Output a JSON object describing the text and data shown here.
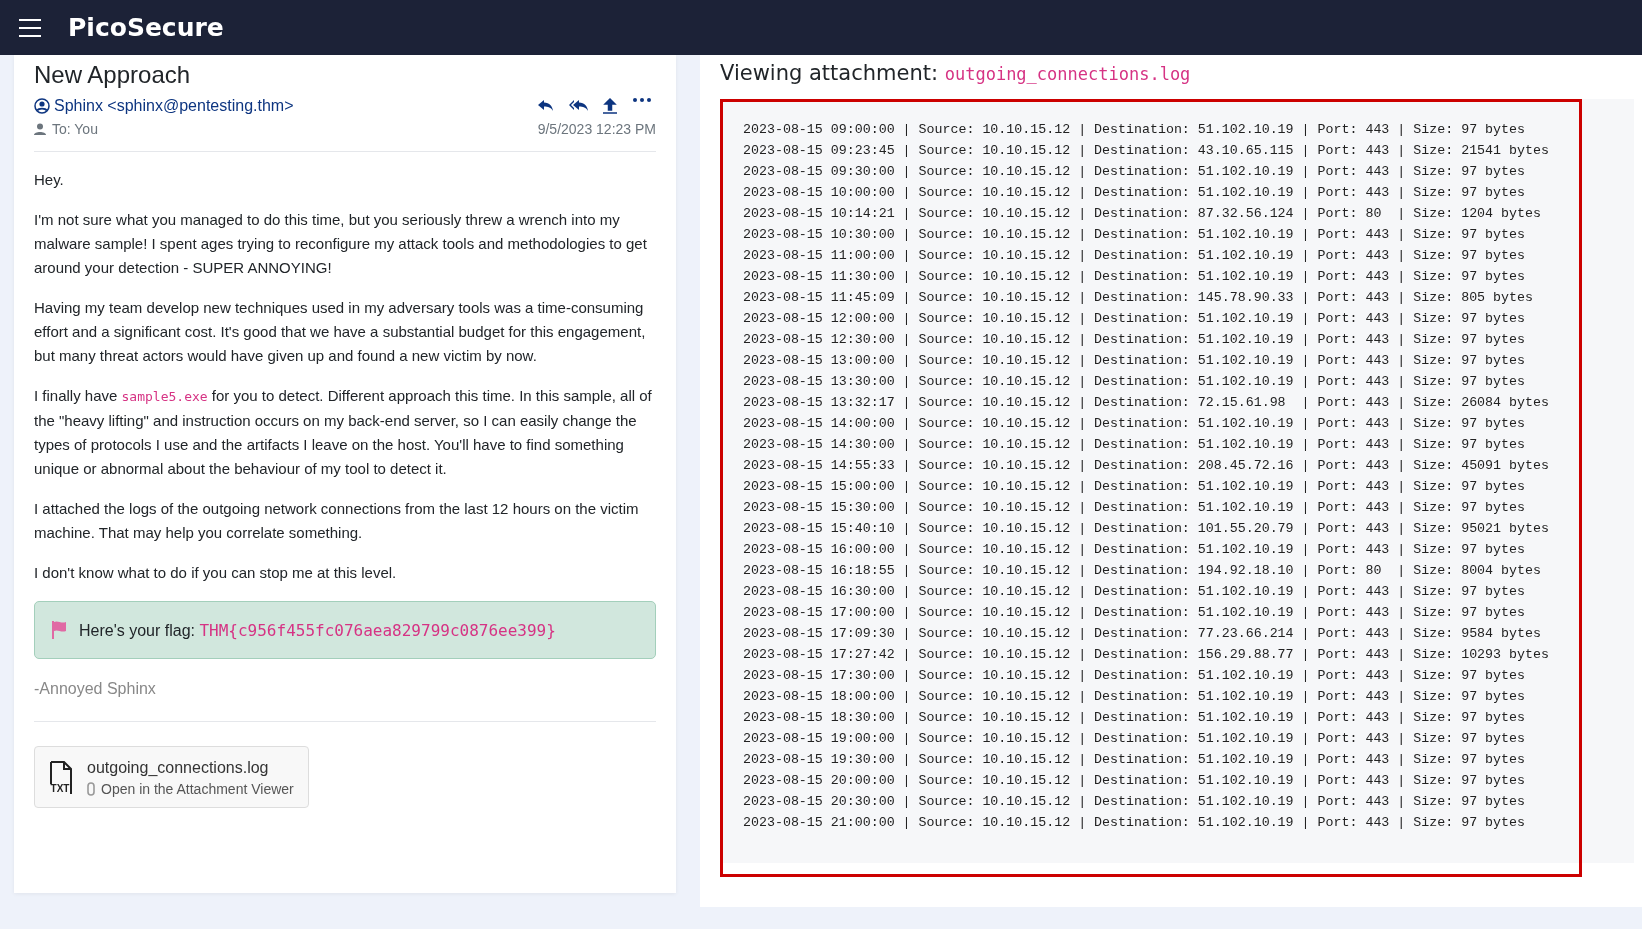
{
  "header": {
    "menu_icon": true,
    "brand": "PicoSecure"
  },
  "email": {
    "subject": "New Approach",
    "sender": "Sphinx <sphinx@pentesting.thm>",
    "recipient": "To: You",
    "date": "9/5/2023 12:23 PM",
    "actions": [
      {
        "kind": "reply"
      },
      {
        "kind": "reply_all"
      },
      {
        "kind": "forward"
      },
      {
        "kind": "more"
      }
    ],
    "body": [
      {
        "text": "Hey."
      },
      {
        "text": "I'm not sure what you managed to do this time, but you seriously threw a wrench into my malware sample! I spent ages trying to reconfigure my attack tools and methodologies to get around your detection - SUPER ANNOYING!"
      },
      {
        "text": "Having my team develop new techniques used in my adversary tools was a time-consuming effort and a significant cost. It's good that we have a substantial budget for this engagement, but many threat actors would have given up and found a new victim by now."
      },
      {
        "text": "I finally have ",
        "code": "sample5.exe",
        "after": " for you to detect. Different approach this time. In this sample, all of the \"heavy lifting\" and instruction occurs on my back-end server, so I can easily change the types of protocols I use and the artifacts I leave on the host. You'll have to find something unique or abnormal about the behaviour of my tool to detect it."
      },
      {
        "text": "I attached the logs of the outgoing network connections from the last 12 hours on the victim machine. That may help you correlate something."
      },
      {
        "text": "I don't know what to do if you can stop me at this level."
      }
    ],
    "flag": {
      "label": "Here's your flag: ",
      "value": "THM{c956f455fc076aea829799c0876ee399}"
    },
    "signature": "-Annoyed Sphinx",
    "attachment": {
      "file_type": "TXT",
      "name": "outgoing_connections.log",
      "action": "Open in the Attachment Viewer"
    }
  },
  "viewer": {
    "label": "Viewing attachment: ",
    "filename": "outgoing_connections.log",
    "lines": [
      "2023-08-15 09:00:00 | Source: 10.10.15.12 | Destination: 51.102.10.19 | Port: 443 | Size: 97 bytes",
      "2023-08-15 09:23:45 | Source: 10.10.15.12 | Destination: 43.10.65.115 | Port: 443 | Size: 21541 bytes",
      "2023-08-15 09:30:00 | Source: 10.10.15.12 | Destination: 51.102.10.19 | Port: 443 | Size: 97 bytes",
      "2023-08-15 10:00:00 | Source: 10.10.15.12 | Destination: 51.102.10.19 | Port: 443 | Size: 97 bytes",
      "2023-08-15 10:14:21 | Source: 10.10.15.12 | Destination: 87.32.56.124 | Port: 80  | Size: 1204 bytes",
      "2023-08-15 10:30:00 | Source: 10.10.15.12 | Destination: 51.102.10.19 | Port: 443 | Size: 97 bytes",
      "2023-08-15 11:00:00 | Source: 10.10.15.12 | Destination: 51.102.10.19 | Port: 443 | Size: 97 bytes",
      "2023-08-15 11:30:00 | Source: 10.10.15.12 | Destination: 51.102.10.19 | Port: 443 | Size: 97 bytes",
      "2023-08-15 11:45:09 | Source: 10.10.15.12 | Destination: 145.78.90.33 | Port: 443 | Size: 805 bytes",
      "2023-08-15 12:00:00 | Source: 10.10.15.12 | Destination: 51.102.10.19 | Port: 443 | Size: 97 bytes",
      "2023-08-15 12:30:00 | Source: 10.10.15.12 | Destination: 51.102.10.19 | Port: 443 | Size: 97 bytes",
      "2023-08-15 13:00:00 | Source: 10.10.15.12 | Destination: 51.102.10.19 | Port: 443 | Size: 97 bytes",
      "2023-08-15 13:30:00 | Source: 10.10.15.12 | Destination: 51.102.10.19 | Port: 443 | Size: 97 bytes",
      "2023-08-15 13:32:17 | Source: 10.10.15.12 | Destination: 72.15.61.98  | Port: 443 | Size: 26084 bytes",
      "2023-08-15 14:00:00 | Source: 10.10.15.12 | Destination: 51.102.10.19 | Port: 443 | Size: 97 bytes",
      "2023-08-15 14:30:00 | Source: 10.10.15.12 | Destination: 51.102.10.19 | Port: 443 | Size: 97 bytes",
      "2023-08-15 14:55:33 | Source: 10.10.15.12 | Destination: 208.45.72.16 | Port: 443 | Size: 45091 bytes",
      "2023-08-15 15:00:00 | Source: 10.10.15.12 | Destination: 51.102.10.19 | Port: 443 | Size: 97 bytes",
      "2023-08-15 15:30:00 | Source: 10.10.15.12 | Destination: 51.102.10.19 | Port: 443 | Size: 97 bytes",
      "2023-08-15 15:40:10 | Source: 10.10.15.12 | Destination: 101.55.20.79 | Port: 443 | Size: 95021 bytes",
      "2023-08-15 16:00:00 | Source: 10.10.15.12 | Destination: 51.102.10.19 | Port: 443 | Size: 97 bytes",
      "2023-08-15 16:18:55 | Source: 10.10.15.12 | Destination: 194.92.18.10 | Port: 80  | Size: 8004 bytes",
      "2023-08-15 16:30:00 | Source: 10.10.15.12 | Destination: 51.102.10.19 | Port: 443 | Size: 97 bytes",
      "2023-08-15 17:00:00 | Source: 10.10.15.12 | Destination: 51.102.10.19 | Port: 443 | Size: 97 bytes",
      "2023-08-15 17:09:30 | Source: 10.10.15.12 | Destination: 77.23.66.214 | Port: 443 | Size: 9584 bytes",
      "2023-08-15 17:27:42 | Source: 10.10.15.12 | Destination: 156.29.88.77 | Port: 443 | Size: 10293 bytes",
      "2023-08-15 17:30:00 | Source: 10.10.15.12 | Destination: 51.102.10.19 | Port: 443 | Size: 97 bytes",
      "2023-08-15 18:00:00 | Source: 10.10.15.12 | Destination: 51.102.10.19 | Port: 443 | Size: 97 bytes",
      "2023-08-15 18:30:00 | Source: 10.10.15.12 | Destination: 51.102.10.19 | Port: 443 | Size: 97 bytes",
      "2023-08-15 19:00:00 | Source: 10.10.15.12 | Destination: 51.102.10.19 | Port: 443 | Size: 97 bytes",
      "2023-08-15 19:30:00 | Source: 10.10.15.12 | Destination: 51.102.10.19 | Port: 443 | Size: 97 bytes",
      "2023-08-15 20:00:00 | Source: 10.10.15.12 | Destination: 51.102.10.19 | Port: 443 | Size: 97 bytes",
      "2023-08-15 20:30:00 | Source: 10.10.15.12 | Destination: 51.102.10.19 | Port: 443 | Size: 97 bytes",
      "2023-08-15 21:00:00 | Source: 10.10.15.12 | Destination: 51.102.10.19 | Port: 443 | Size: 97 bytes"
    ]
  }
}
